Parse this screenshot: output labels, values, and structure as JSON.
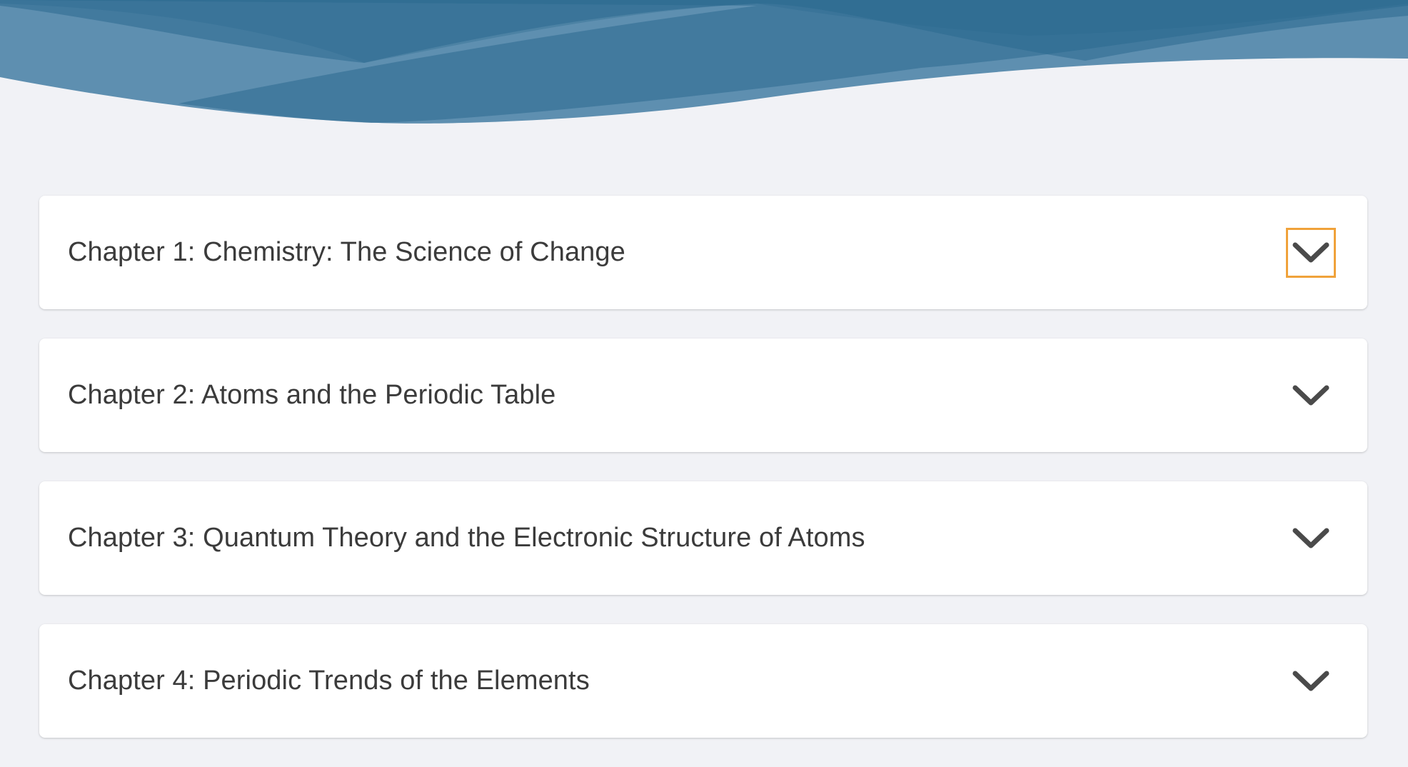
{
  "colors": {
    "background": "#f1f2f6",
    "wave_dark": "#2c6990",
    "wave_light": "#5e8fb0",
    "focus_ring": "#f0a23a",
    "title_text": "#3b3b3b"
  },
  "chapters": [
    {
      "title": "Chapter 1: Chemistry: The Science of Change",
      "expanded": false,
      "focused": true,
      "toggle_icon": "chevron-down-icon"
    },
    {
      "title": "Chapter 2: Atoms and the Periodic Table",
      "expanded": false,
      "focused": false,
      "toggle_icon": "chevron-down-icon"
    },
    {
      "title": "Chapter 3: Quantum Theory and the Electronic Structure of Atoms",
      "expanded": false,
      "focused": false,
      "toggle_icon": "chevron-down-icon"
    },
    {
      "title": "Chapter 4: Periodic Trends of the Elements",
      "expanded": false,
      "focused": false,
      "toggle_icon": "chevron-down-icon"
    }
  ]
}
